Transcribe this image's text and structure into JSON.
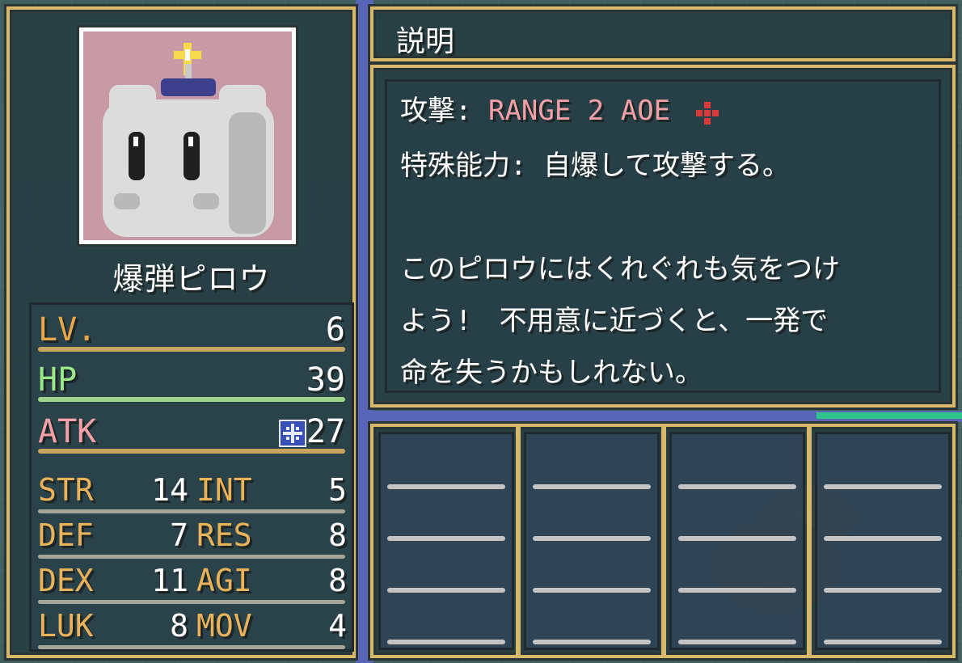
{
  "character": {
    "name": "爆弾ピロウ",
    "portrait_bg_color": "#c89aa6"
  },
  "stats": {
    "lv": {
      "label": "LV.",
      "value": "6"
    },
    "hp": {
      "label": "HP",
      "value": "39"
    },
    "atk": {
      "label": "ATK",
      "value": "27",
      "icon": "magic-snowflake-icon"
    },
    "rows": [
      {
        "l1": "STR",
        "v1": "14",
        "l2": "INT",
        "v2": "5"
      },
      {
        "l1": "DEF",
        "v1": "7",
        "l2": "RES",
        "v2": "8"
      },
      {
        "l1": "DEX",
        "v1": "11",
        "l2": "AGI",
        "v2": "8"
      },
      {
        "l1": "LUK",
        "v1": "8",
        "l2": "MOV",
        "v2": "4"
      }
    ]
  },
  "description": {
    "title": "説明",
    "attack_label": "攻撃:",
    "attack_value": "RANGE 2 AOE",
    "attack_icon": "red-cross-icon",
    "ability_label": "特殊能力:",
    "ability_value": "自爆して攻撃する。",
    "flavor_lines": [
      "このピロウにはくれぐれも気をつけ",
      "よう!　不用意に近づくと、一発で",
      "命を失うかもしれない。"
    ]
  },
  "colors": {
    "frame": "#d8b86a",
    "lv": "#e8a74a",
    "hp": "#9be88a",
    "atk": "#f4a0a8"
  }
}
